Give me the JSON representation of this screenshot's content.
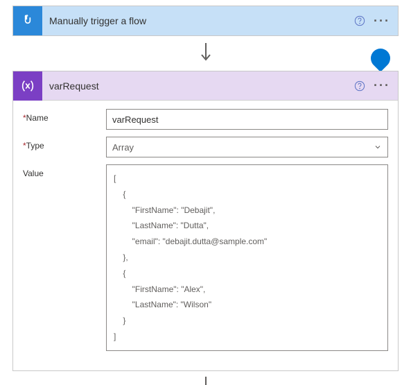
{
  "trigger": {
    "title": "Manually trigger a flow"
  },
  "action": {
    "title": "varRequest",
    "fields": {
      "name_label": "Name",
      "type_label": "Type",
      "value_label": "Value",
      "name_value": "varRequest",
      "type_value": "Array",
      "value_content": "[\n    {\n        \"FirstName\": \"Debajit\",\n        \"LastName\": \"Dutta\",\n        \"email\": \"debajit.dutta@sample.com\"\n    },\n    {\n        \"FirstName\": \"Alex\",\n        \"LastName\": \"Wilson\"\n    }\n]"
    }
  }
}
